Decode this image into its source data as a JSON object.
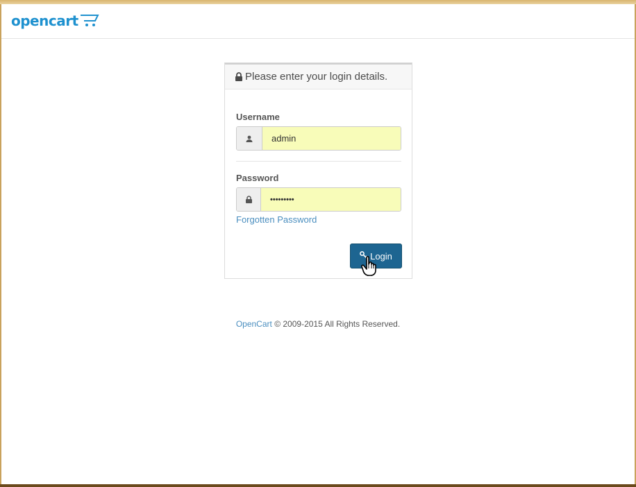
{
  "brand": {
    "logo_text": "opencart",
    "accent_color": "#1e91cf"
  },
  "login": {
    "heading": "Please enter your login details.",
    "username_label": "Username",
    "username_value": "admin",
    "password_label": "Password",
    "password_value": "•••••••••",
    "forgot_link": "Forgotten Password",
    "login_button": "Login"
  },
  "icons": {
    "heading": "lock-icon",
    "username": "user-icon",
    "password": "lock-icon",
    "login_button": "key-icon",
    "cursor": "hand-pointer-icon"
  },
  "footer": {
    "link": "OpenCart",
    "text": "© 2009-2015 All Rights Reserved."
  },
  "colors": {
    "input_autofill": "#f8fcb9",
    "button_primary": "#1d6591",
    "link": "#4a8ebf"
  }
}
